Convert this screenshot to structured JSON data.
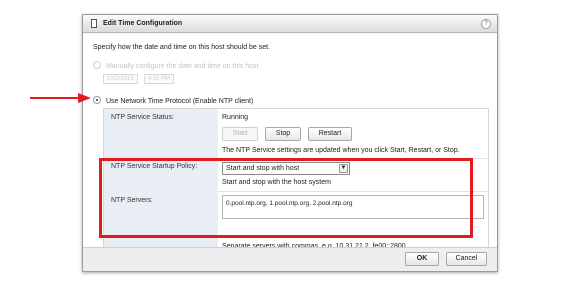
{
  "dialog": {
    "title": "Edit Time Configuration",
    "help": "?",
    "intro": "Specify how the date and time on this host should be set.",
    "manual_option": "Manually configure the date and time on this host",
    "manual_date": "1/02/2013",
    "manual_time": "4:32 PM",
    "ntp_option": "Use Network Time Protocol (Enable NTP client)"
  },
  "ntp": {
    "service_status_label": "NTP Service Status:",
    "service_status_value": "Running",
    "start_label": "Start",
    "stop_label": "Stop",
    "restart_label": "Restart",
    "status_note": "The NTP Service settings are updated when you click Start, Restart, or Stop.",
    "startup_policy_label": "NTP Service Startup Policy:",
    "startup_policy_value": "Start and stop with host",
    "startup_policy_note": "Start and stop with the host system",
    "servers_label": "NTP Servers:",
    "servers_value": "0.pool.ntp.org, 1.pool.ntp.org, 2.pool.ntp.org",
    "servers_note": "Separate servers with commas, e.g. 10.31.21.2, fe00::2800"
  },
  "footer": {
    "ok_label": "OK",
    "cancel_label": "Cancel"
  },
  "colors": {
    "highlight_red": "#e11b22",
    "label_column_bg": "#e9eef4"
  }
}
